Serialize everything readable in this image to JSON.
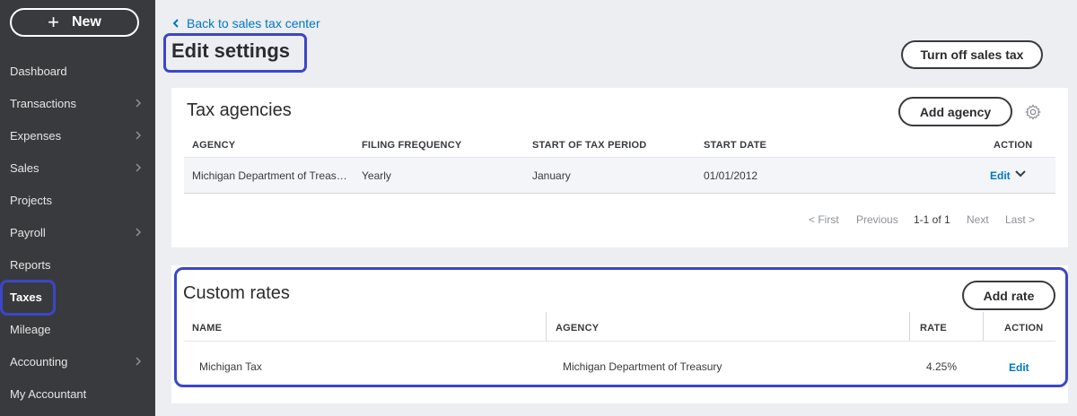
{
  "sidebar": {
    "new_label": "New",
    "items": [
      {
        "label": "Dashboard",
        "chevron": false
      },
      {
        "label": "Transactions",
        "chevron": true
      },
      {
        "label": "Expenses",
        "chevron": true
      },
      {
        "label": "Sales",
        "chevron": true
      },
      {
        "label": "Projects",
        "chevron": false
      },
      {
        "label": "Payroll",
        "chevron": true
      },
      {
        "label": "Reports",
        "chevron": false
      },
      {
        "label": "Taxes",
        "chevron": false
      },
      {
        "label": "Mileage",
        "chevron": false
      },
      {
        "label": "Accounting",
        "chevron": true
      },
      {
        "label": "My Accountant",
        "chevron": false
      }
    ]
  },
  "header": {
    "back_link": "Back to sales tax center",
    "title": "Edit settings",
    "turn_off_label": "Turn off sales tax"
  },
  "agencies": {
    "title": "Tax agencies",
    "add_label": "Add agency",
    "columns": [
      "AGENCY",
      "FILING FREQUENCY",
      "START OF TAX PERIOD",
      "START DATE",
      "ACTION"
    ],
    "rows": [
      {
        "agency": "Michigan Department of Treas…",
        "frequency": "Yearly",
        "period_start": "January",
        "start_date": "01/01/2012",
        "action": "Edit"
      }
    ],
    "pager": {
      "first": "< First",
      "previous": "Previous",
      "range": "1-1 of 1",
      "next": "Next",
      "last": "Last >"
    }
  },
  "rates": {
    "title": "Custom rates",
    "add_label": "Add rate",
    "columns": [
      "NAME",
      "AGENCY",
      "RATE",
      "ACTION"
    ],
    "rows": [
      {
        "name": "Michigan Tax",
        "agency": "Michigan Department of Treasury",
        "rate": "4.25%",
        "action": "Edit"
      }
    ]
  },
  "colors": {
    "sidebar_bg": "#393a3d",
    "link": "#0077c5",
    "highlight": "#3c46c8"
  }
}
